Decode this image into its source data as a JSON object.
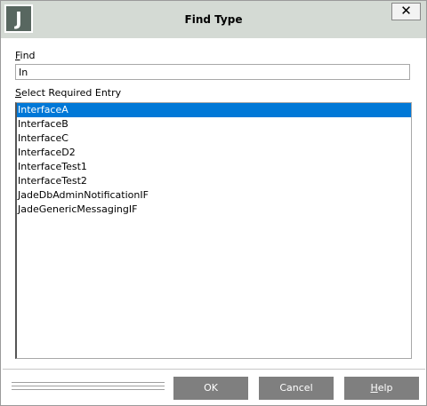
{
  "window": {
    "title": "Find Type",
    "app_icon_letter": "J",
    "close_symbol": "✕"
  },
  "find": {
    "label_mnemonic": "F",
    "label_rest": "ind",
    "value": "In"
  },
  "entries": {
    "label_mnemonic": "S",
    "label_rest": "elect Required Entry",
    "items": [
      "InterfaceA",
      "InterfaceB",
      "InterfaceC",
      "InterfaceD2",
      "InterfaceTest1",
      "InterfaceTest2",
      "JadeDbAdminNotificationIF",
      "JadeGenericMessagingIF"
    ],
    "selected_index": 0
  },
  "buttons": {
    "ok_label": "OK",
    "cancel_label": "Cancel",
    "help_mnemonic": "H",
    "help_rest": "elp"
  },
  "colors": {
    "titlebar": "#d4dad4",
    "app_icon_bg": "#586760",
    "selection": "#0078d7",
    "button_bg": "#7f7f7f"
  }
}
